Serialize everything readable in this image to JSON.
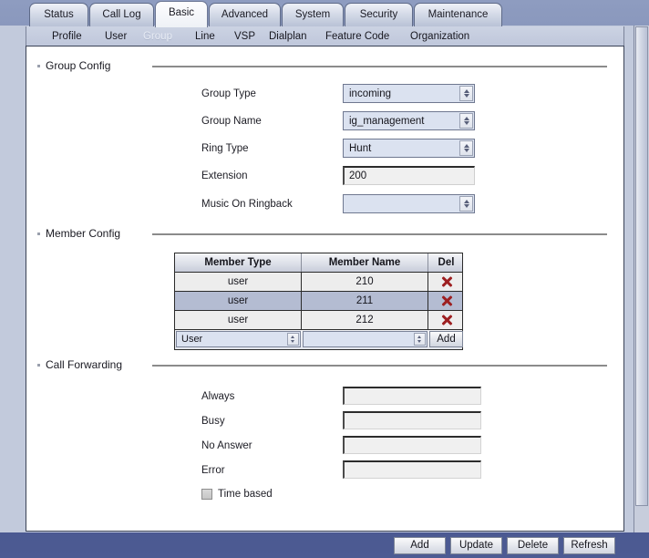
{
  "tabs": [
    {
      "label": "Status",
      "active": false
    },
    {
      "label": "Call Log",
      "active": false
    },
    {
      "label": "Basic",
      "active": true
    },
    {
      "label": "Advanced",
      "active": false
    },
    {
      "label": "System",
      "active": false
    },
    {
      "label": "Security",
      "active": false
    },
    {
      "label": "Maintenance",
      "active": false
    }
  ],
  "subnav": [
    {
      "label": "Profile",
      "active": false
    },
    {
      "label": "User",
      "active": false
    },
    {
      "label": "Group",
      "active": true
    },
    {
      "label": "Line",
      "active": false
    },
    {
      "label": "VSP",
      "active": false
    },
    {
      "label": "Dialplan",
      "active": false
    },
    {
      "label": "Feature Code",
      "active": false
    },
    {
      "label": "Organization",
      "active": false
    }
  ],
  "group_config": {
    "title": "Group Config",
    "fields": [
      {
        "label": "Group Type",
        "value": "incoming",
        "control": "select"
      },
      {
        "label": "Group Name",
        "value": "ig_management",
        "control": "select"
      },
      {
        "label": "Ring Type",
        "value": "Hunt",
        "control": "select"
      },
      {
        "label": "Extension",
        "value": "200",
        "control": "text"
      },
      {
        "label": "Music On Ringback",
        "value": "",
        "control": "select"
      }
    ]
  },
  "member_config": {
    "title": "Member Config",
    "columns": [
      "Member Type",
      "Member Name",
      "Del"
    ],
    "rows": [
      {
        "type": "user",
        "name": "210",
        "selected": false,
        "del_icon": "delete-x-icon"
      },
      {
        "type": "user",
        "name": "211",
        "selected": true,
        "del_icon": "delete-x-icon"
      },
      {
        "type": "user",
        "name": "212",
        "selected": false,
        "del_icon": "delete-x-icon"
      }
    ],
    "add_row": {
      "type_value": "User",
      "name_value": "",
      "add_label": "Add"
    }
  },
  "call_forwarding": {
    "title": "Call Forwarding",
    "fields": [
      {
        "label": "Always",
        "value": ""
      },
      {
        "label": "Busy",
        "value": ""
      },
      {
        "label": "No Answer",
        "value": ""
      },
      {
        "label": "Error",
        "value": ""
      }
    ],
    "time_based": {
      "label": "Time based",
      "checked": false
    }
  },
  "footer_buttons": [
    {
      "label": "Add"
    },
    {
      "label": "Update"
    },
    {
      "label": "Delete"
    },
    {
      "label": "Refresh"
    }
  ],
  "colors": {
    "chrome_blue": "#4d5b93",
    "panel_bg": "#ffffff",
    "field_bg": "#c2cadc",
    "select_bg": "#dbe2f0",
    "row_selected": "#b4bcd2",
    "delete_red": "#9d1f21"
  }
}
